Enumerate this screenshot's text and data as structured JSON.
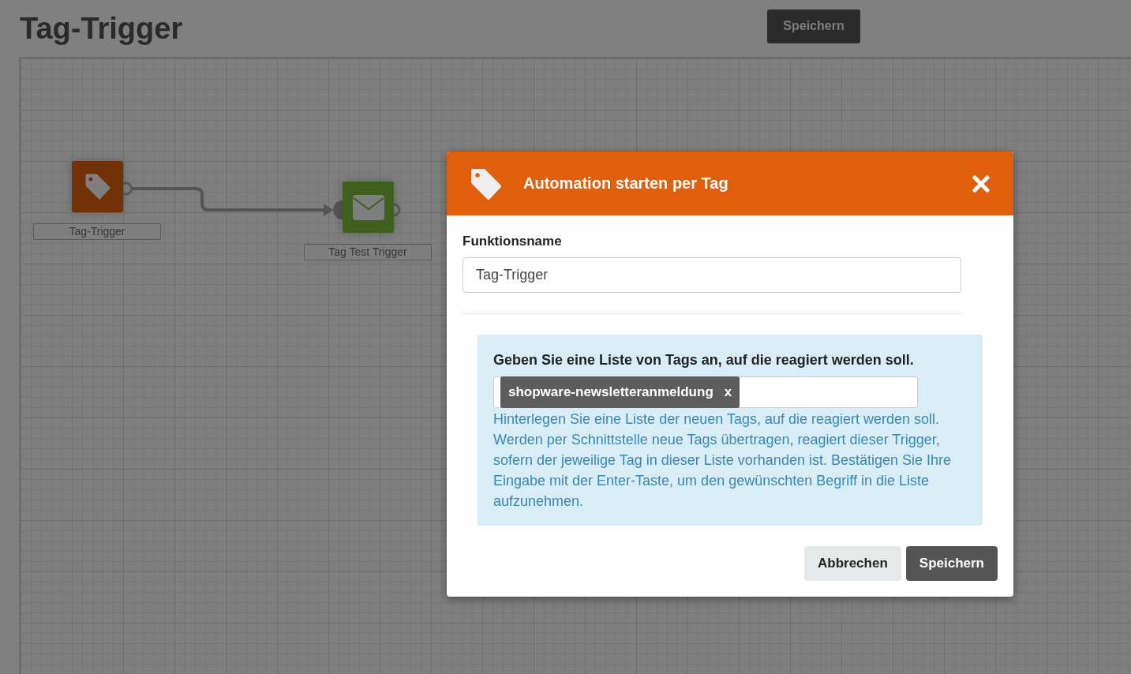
{
  "page": {
    "title": "Tag-Trigger",
    "save_button": "Speichern"
  },
  "canvas": {
    "nodes": [
      {
        "kind": "tag",
        "label": "Tag-Trigger",
        "color": "#723106"
      },
      {
        "kind": "mail",
        "label": "Tag Test Trigger",
        "color": "#3f611d"
      }
    ]
  },
  "dialog": {
    "title": "Automation starten per Tag",
    "field_label": "Funktionsname",
    "field_value": "Tag-Trigger",
    "info": {
      "heading": "Geben Sie eine Liste von Tags an, auf die reagiert werden soll.",
      "tags": [
        {
          "label": "shopware-newsletteranmeldung",
          "remove": "x"
        }
      ],
      "help": "Hinterlegen Sie eine Liste der neuen Tags, auf die reagiert werden soll. Werden per Schnittstelle neue Tags übertragen, reagiert dieser Trigger, sofern der jeweilige Tag in dieser Liste vorhanden ist. Bestätigen Sie Ihre Eingabe mit der Enter-Taste, um den gewünschten Begriff in die Liste aufzunehmen."
    },
    "buttons": [
      {
        "kind": "secondary",
        "label": "Abbrechen"
      },
      {
        "kind": "primary",
        "label": "Speichern"
      }
    ]
  }
}
